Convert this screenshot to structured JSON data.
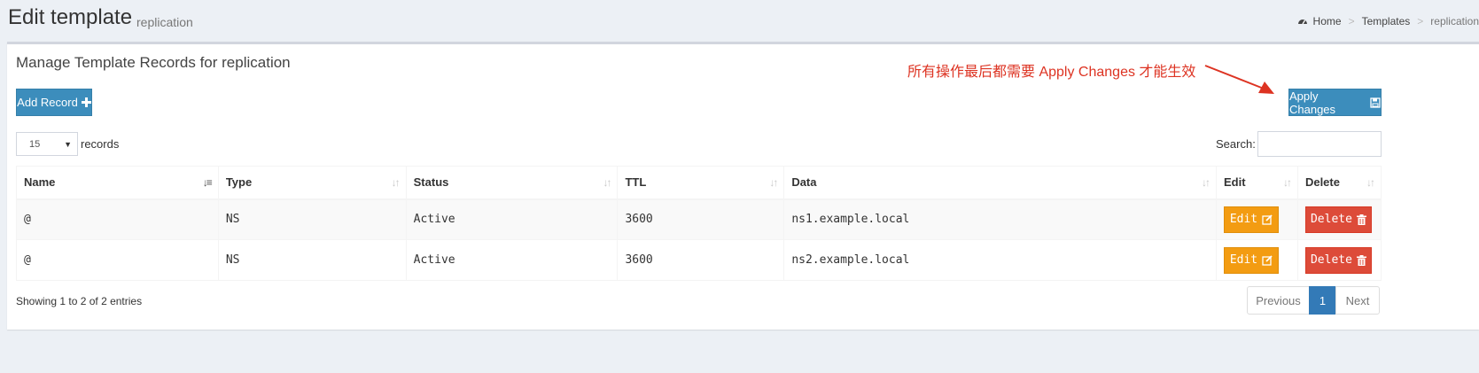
{
  "header": {
    "title": "Edit template",
    "subtitle": "replication",
    "breadcrumb": {
      "home": "Home",
      "templates": "Templates",
      "current": "replication",
      "separator": ">"
    }
  },
  "box": {
    "title": "Manage Template Records for replication",
    "note": "所有操作最后都需要 Apply Changes 才能生效",
    "add_record_label": "Add Record",
    "apply_changes_label": "Apply Changes"
  },
  "table_controls": {
    "page_length": "15",
    "records_label": "records",
    "search_label": "Search:",
    "search_value": ""
  },
  "table": {
    "columns": [
      "Name",
      "Type",
      "Status",
      "TTL",
      "Data",
      "Edit",
      "Delete"
    ],
    "rows": [
      {
        "name": "@",
        "type": "NS",
        "status": "Active",
        "ttl": "3600",
        "data": "ns1.example.local"
      },
      {
        "name": "@",
        "type": "NS",
        "status": "Active",
        "ttl": "3600",
        "data": "ns2.example.local"
      }
    ],
    "edit_label": "Edit",
    "delete_label": "Delete"
  },
  "footer": {
    "info": "Showing 1 to 2 of 2 entries",
    "previous": "Previous",
    "current_page": "1",
    "next": "Next"
  },
  "colors": {
    "primary": "#3c8dbc",
    "warning": "#f39c12",
    "danger": "#dd4b39",
    "note": "#dd3322",
    "pager_active": "#337ab7"
  }
}
